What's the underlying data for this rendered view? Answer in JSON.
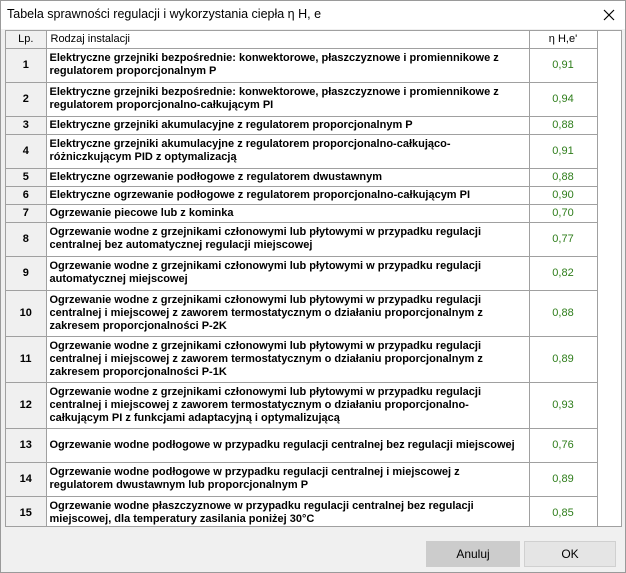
{
  "window": {
    "title": "Tabela sprawności regulacji i wykorzystania ciepła η H, e"
  },
  "table": {
    "headers": {
      "lp": "Lp.",
      "type": "Rodzaj instalacji",
      "value": "η H,e'"
    },
    "rows": [
      {
        "lp": "1",
        "type": "Elektryczne grzejniki bezpośrednie: konwektorowe, płaszczyznowe i promiennikowe z regulatorem proporcjonalnym P",
        "value": "0,91"
      },
      {
        "lp": "2",
        "type": "Elektryczne grzejniki bezpośrednie: konwektorowe, płaszczyznowe i promiennikowe z regulatorem proporcjonalno-całkującym PI",
        "value": "0,94"
      },
      {
        "lp": "3",
        "type": "Elektryczne grzejniki akumulacyjne z regulatorem proporcjonalnym P",
        "value": "0,88"
      },
      {
        "lp": "4",
        "type": "Elektryczne grzejniki akumulacyjne z regulatorem proporcjonalno-całkująco-różniczkującym PID z optymalizacją",
        "value": "0,91"
      },
      {
        "lp": "5",
        "type": "Elektryczne ogrzewanie podłogowe z regulatorem dwustawnym",
        "value": "0,88"
      },
      {
        "lp": "6",
        "type": "Elektryczne ogrzewanie podłogowe z regulatorem proporcjonalno-całkującym PI",
        "value": "0,90"
      },
      {
        "lp": "7",
        "type": "Ogrzewanie piecowe lub z kominka",
        "value": "0,70"
      },
      {
        "lp": "8",
        "type": "Ogrzewanie wodne z grzejnikami członowymi lub płytowymi w przypadku regulacji centralnej bez automatycznej regulacji miejscowej",
        "value": "0,77"
      },
      {
        "lp": "9",
        "type": "Ogrzewanie wodne z grzejnikami członowymi lub płytowymi w przypadku regulacji automatycznej miejscowej",
        "value": "0,82"
      },
      {
        "lp": "10",
        "type": "Ogrzewanie wodne z grzejnikami członowymi lub płytowymi w przypadku regulacji centralnej i miejscowej z zaworem termostatycznym o działaniu proporcjonalnym z zakresem proporcjonalności P-2K",
        "value": "0,88"
      },
      {
        "lp": "11",
        "type": "Ogrzewanie wodne z grzejnikami członowymi lub płytowymi w przypadku regulacji centralnej i miejscowej z zaworem termostatycznym o działaniu proporcjonalnym z zakresem proporcjonalności P-1K",
        "value": "0,89"
      },
      {
        "lp": "12",
        "type": "Ogrzewanie wodne z grzejnikami członowymi lub płytowymi w przypadku regulacji centralnej i miejscowej z zaworem termostatycznym o działaniu proporcjonalno-całkującym PI z funkcjami adaptacyjną i optymalizującą",
        "value": "0,93"
      },
      {
        "lp": "13",
        "type": "Ogrzewanie wodne podłogowe w przypadku regulacji centralnej bez regulacji miejscowej",
        "value": "0,76"
      },
      {
        "lp": "14",
        "type": "Ogrzewanie wodne podłogowe w przypadku regulacji centralnej i miejscowej z regulatorem dwustawnym lub proporcjonalnym P",
        "value": "0,89"
      },
      {
        "lp": "15",
        "type": "Ogrzewanie wodne płaszczyznowe w przypadku regulacji centralnej bez regulacji miejscowej, dla temperatury zasilania poniżej 30°C",
        "value": "0,85"
      }
    ]
  },
  "buttons": {
    "cancel": "Anuluj",
    "ok": "OK"
  },
  "colors": {
    "value_text": "#2e7d1a",
    "cancel_bg": "#cccccc",
    "ok_bg": "#e5e5e5"
  },
  "icons": {
    "close": "close-icon"
  }
}
